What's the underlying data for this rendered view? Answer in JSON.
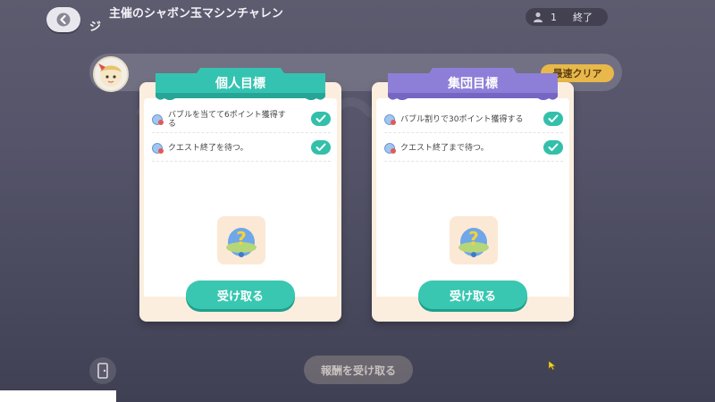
{
  "header": {
    "title": "主催のシャボン玉マシンチャレンジ",
    "player_count": "1",
    "status": "終了"
  },
  "badge": {
    "fast_clear": "最速クリア"
  },
  "cards": [
    {
      "header": "個人目標",
      "header_color": "#35c3b1",
      "tasks": [
        {
          "text": "バブルを当てて6ポイント獲得する",
          "done": true
        },
        {
          "text": "クエスト終了を待つ。",
          "done": true
        }
      ],
      "reward_icon": "mystery-egg-icon",
      "button": "受け取る"
    },
    {
      "header": "集団目標",
      "header_color": "#8d7fd8",
      "tasks": [
        {
          "text": "バブル割りで30ポイント獲得する",
          "done": true
        },
        {
          "text": "クエスト終了まで待つ。",
          "done": true
        }
      ],
      "reward_icon": "mystery-egg-icon",
      "button": "受け取る"
    }
  ],
  "footer": {
    "claim_all": "報酬を受け取る"
  },
  "colors": {
    "teal": "#39c7b1",
    "purple": "#8d7fd8",
    "card_bg": "#fbeede",
    "gold_badge": "#e8b84a"
  }
}
